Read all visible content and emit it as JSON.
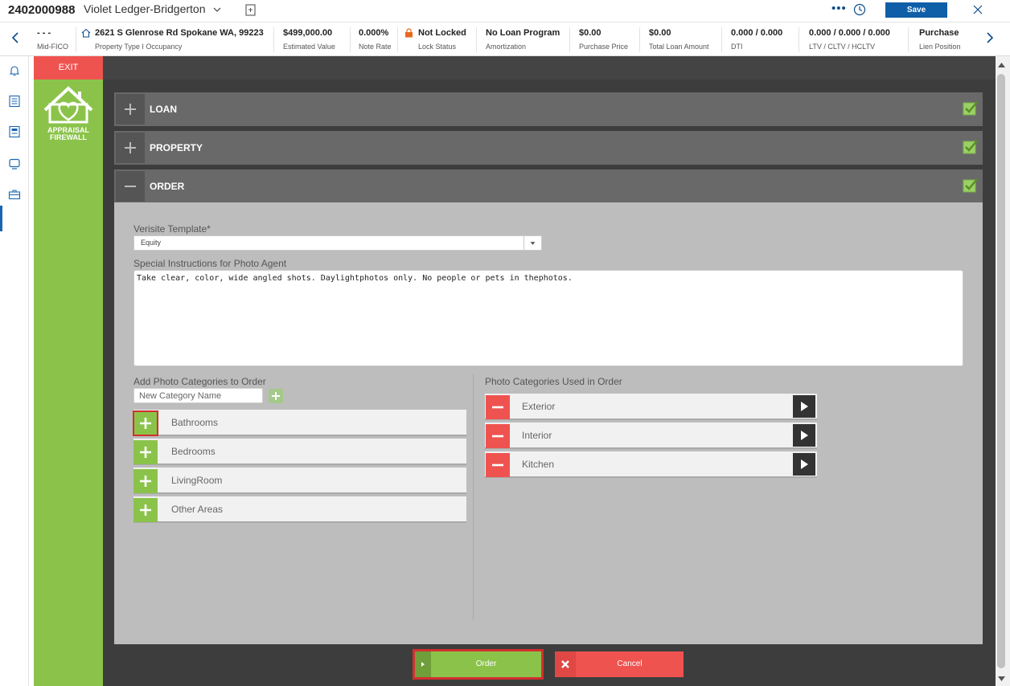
{
  "header": {
    "loan_number": "2402000988",
    "borrower_name": "Violet Ledger-Bridgerton",
    "save_label": "Save"
  },
  "info_strip": {
    "fields": [
      {
        "value": "- - -",
        "label": "Mid-FICO"
      },
      {
        "value": "2621 S Glenrose Rd Spokane WA, 99223",
        "label": "Property Type I Occupancy"
      },
      {
        "value": "$499,000.00",
        "label": "Estimated Value"
      },
      {
        "value": "0.000%",
        "label": "Note Rate"
      },
      {
        "value": "Not Locked",
        "label": "Lock Status"
      },
      {
        "value": "No Loan Program",
        "label": "Amortization"
      },
      {
        "value": "$0.00",
        "label": "Purchase Price"
      },
      {
        "value": "$0.00",
        "label": "Total Loan Amount"
      },
      {
        "value": "0.000 / 0.000",
        "label": "DTI"
      },
      {
        "value": "0.000 / 0.000 / 0.000",
        "label": "LTV / CLTV / HCLTV"
      },
      {
        "value": "Purchase",
        "label": "Lien Position"
      }
    ]
  },
  "appraisal": {
    "exit_label": "EXIT",
    "logo_text_1": "APPRAISAL",
    "logo_text_2": "FIREWALL",
    "sections": [
      {
        "title": "LOAN",
        "expanded": false
      },
      {
        "title": "PROPERTY",
        "expanded": false
      },
      {
        "title": "ORDER",
        "expanded": true
      }
    ],
    "order": {
      "template_label": "Verisite Template*",
      "template_value": "Equity",
      "instructions_label": "Special Instructions for Photo Agent",
      "instructions_value": "Take clear, color, wide angled shots. Daylightphotos only. No people or pets in thephotos.",
      "add_categories_label": "Add Photo Categories to Order",
      "new_category_placeholder": "New Category Name",
      "available_categories": [
        "Bathrooms",
        "Bedrooms",
        "LivingRoom",
        "Other Areas"
      ],
      "used_categories_label": "Photo Categories Used in Order",
      "used_categories": [
        "Exterior",
        "Interior",
        "Kitchen"
      ]
    },
    "order_button_label": "Order",
    "cancel_button_label": "Cancel"
  },
  "colors": {
    "accent_green": "#8bc34a",
    "accent_red": "#ef5350",
    "save_blue": "#0f5ea8",
    "lock_orange": "#e8681e"
  }
}
